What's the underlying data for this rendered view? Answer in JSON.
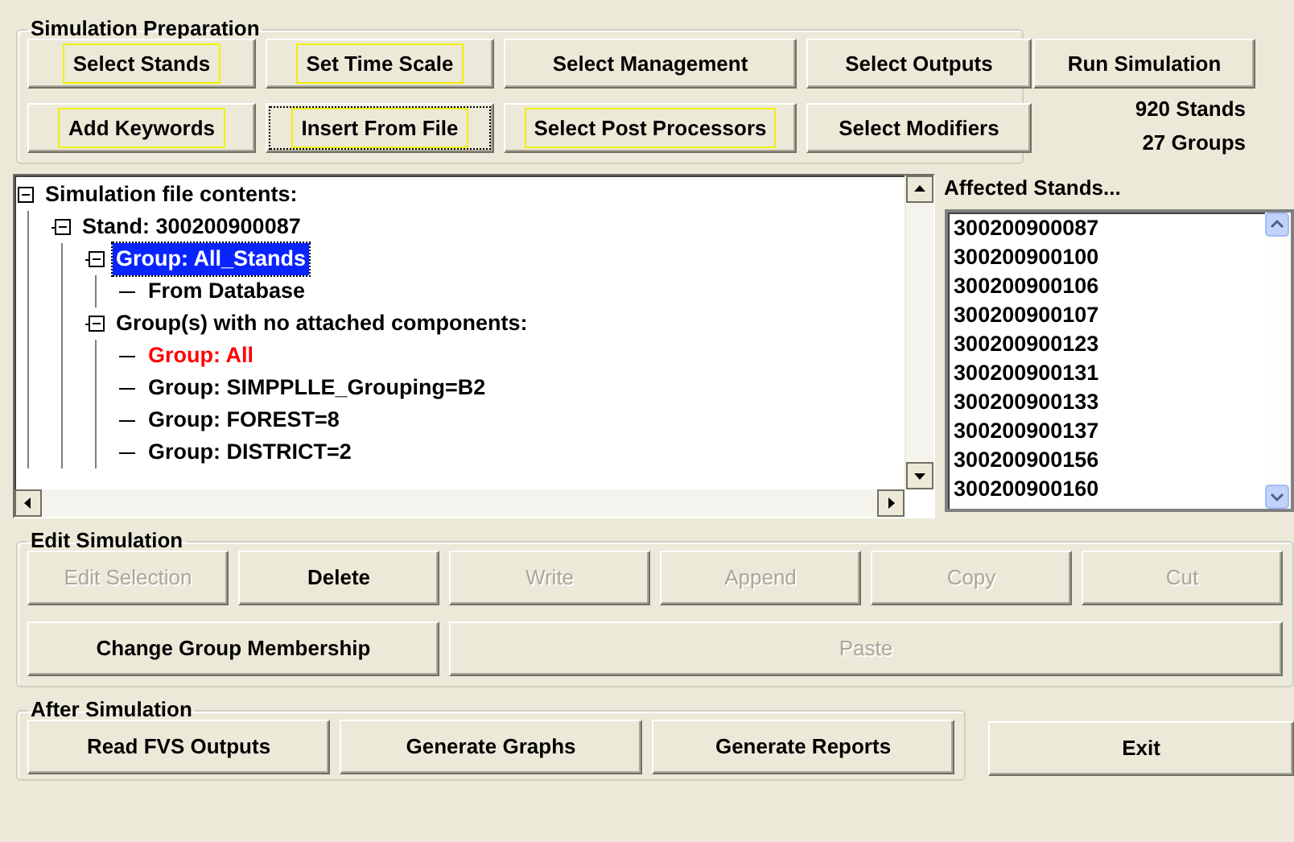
{
  "preparation": {
    "title": "Simulation Preparation",
    "buttons": [
      {
        "label": "Select Stands",
        "highlighted": true,
        "focused": false
      },
      {
        "label": "Set Time Scale",
        "highlighted": true,
        "focused": false
      },
      {
        "label": "Select Management",
        "highlighted": false,
        "focused": false
      },
      {
        "label": "Select Outputs",
        "highlighted": false,
        "focused": false
      },
      {
        "label": "Add Keywords",
        "highlighted": true,
        "focused": false
      },
      {
        "label": "Insert From File",
        "highlighted": true,
        "focused": true
      },
      {
        "label": "Select Post Processors",
        "highlighted": true,
        "focused": false
      },
      {
        "label": "Select Modifiers",
        "highlighted": false,
        "focused": false
      }
    ]
  },
  "run_button": {
    "label": "Run Simulation"
  },
  "counts": [
    "920 Stands",
    "27 Groups"
  ],
  "tree": [
    {
      "label": "Simulation file contents:",
      "expanded": true,
      "selected": false,
      "children": [
        {
          "label": "Stand: 300200900087",
          "expanded": true,
          "selected": false,
          "children": [
            {
              "label": "Group: All_Stands",
              "expanded": true,
              "selected": true,
              "children": [
                {
                  "label": "From Database",
                  "selected": false
                }
              ]
            },
            {
              "label": "Group(s) with no attached components:",
              "expanded": true,
              "selected": false,
              "children": [
                {
                  "label": "Group: All",
                  "selected": false,
                  "color": "#ff0000"
                },
                {
                  "label": "Group: SIMPPLLE_Grouping=B2",
                  "selected": false
                },
                {
                  "label": "Group: FOREST=8",
                  "selected": false
                },
                {
                  "label": "Group: DISTRICT=2",
                  "selected": false
                }
              ]
            }
          ]
        }
      ]
    }
  ],
  "affected": {
    "title": "Affected Stands...",
    "items": [
      "300200900087",
      "300200900100",
      "300200900106",
      "300200900107",
      "300200900123",
      "300200900131",
      "300200900133",
      "300200900137",
      "300200900156",
      "300200900160"
    ]
  },
  "edit": {
    "title": "Edit Simulation",
    "buttons": [
      {
        "label": "Edit Selection",
        "disabled": true
      },
      {
        "label": "Delete",
        "disabled": false
      },
      {
        "label": "Write",
        "disabled": true
      },
      {
        "label": "Append",
        "disabled": true
      },
      {
        "label": "Copy",
        "disabled": true
      },
      {
        "label": "Cut",
        "disabled": true
      },
      {
        "label": "Change Group Membership",
        "disabled": false
      },
      {
        "label": "Paste",
        "disabled": true
      }
    ]
  },
  "after": {
    "title": "After Simulation",
    "buttons": [
      {
        "label": "Read FVS Outputs"
      },
      {
        "label": "Generate Graphs"
      },
      {
        "label": "Generate Reports"
      }
    ]
  },
  "exit_button": {
    "label": "Exit"
  }
}
